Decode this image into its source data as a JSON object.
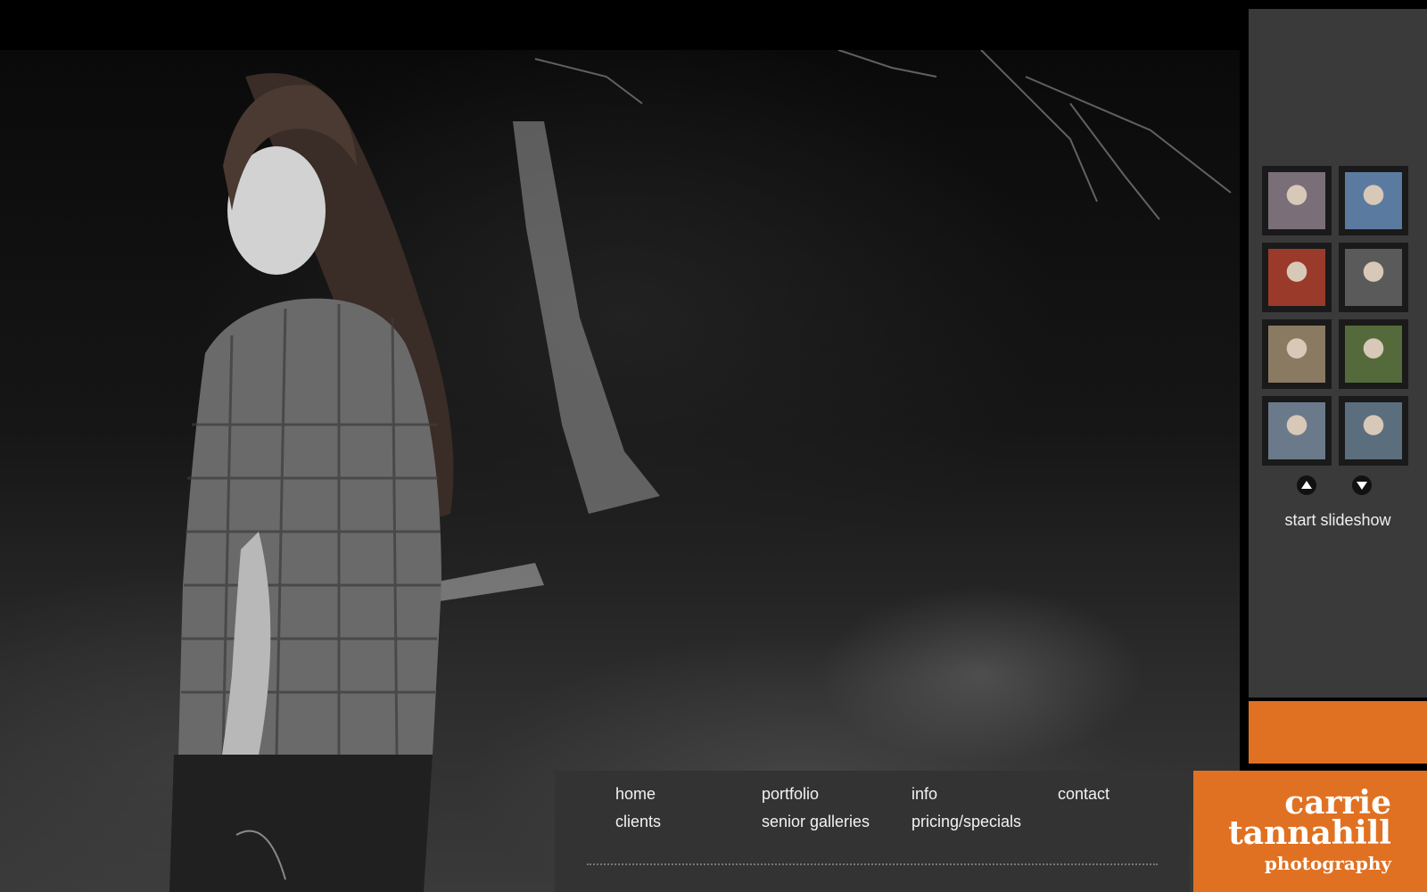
{
  "hero": {
    "icon": "portrait-photo"
  },
  "gallery": {
    "thumbnails": [
      {
        "icon": "thumbnail-photo",
        "color": "#7a6f78"
      },
      {
        "icon": "thumbnail-photo",
        "color": "#5b7aa0"
      },
      {
        "icon": "thumbnail-photo",
        "color": "#9a3a2a"
      },
      {
        "icon": "thumbnail-photo",
        "color": "#5a5a5a"
      },
      {
        "icon": "thumbnail-photo",
        "color": "#8a7a62"
      },
      {
        "icon": "thumbnail-photo",
        "color": "#556a3a"
      },
      {
        "icon": "thumbnail-photo",
        "color": "#6a7a8a"
      },
      {
        "icon": "thumbnail-photo",
        "color": "#5a6e7e"
      }
    ],
    "scroll_up_icon": "arrow-up-icon",
    "scroll_down_icon": "arrow-down-icon",
    "slideshow_label": "start slideshow"
  },
  "nav": {
    "row1": [
      "home",
      "portfolio",
      "info",
      "contact"
    ],
    "row2": [
      "clients",
      "senior galleries",
      "pricing/specials"
    ]
  },
  "logo": {
    "line1": "carrie",
    "line2": "tannahill",
    "line3": "photography"
  },
  "colors": {
    "accent": "#e07122",
    "panel": "#333333",
    "sidebar": "#3a3a3a"
  }
}
